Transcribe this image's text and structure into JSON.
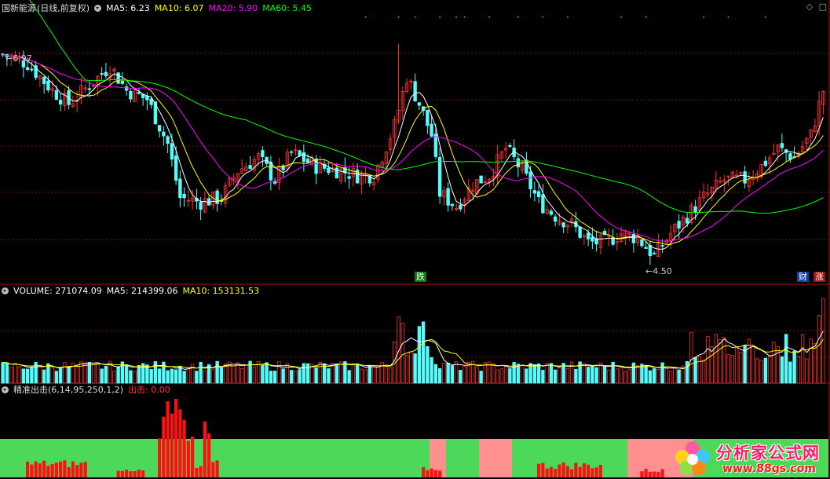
{
  "main_header": {
    "stock": "国新能源",
    "mode": "(日线,前复权)",
    "ma5": "MA5: 6.23",
    "ma10": "MA10: 6.07",
    "ma20": "MA20: 5.90",
    "ma60": "MA60: 5.45"
  },
  "vol_header": {
    "vol": "VOLUME: 271074.09",
    "ma5": "MA5: 214399.06",
    "ma10": "MA10: 153131.53"
  },
  "ind_header": {
    "name": "精准出击(6,14,95,250,1,2)",
    "value": "出击: 0.00"
  },
  "annotations": {
    "high_label": "6.97",
    "low_label": "4.50",
    "tag_fall": "跌",
    "tag_fin": "财",
    "tag_rise": "涨"
  },
  "watermark": {
    "title": "分析家公式网",
    "url": "www.88gs.com"
  },
  "icons": [
    "menu-dot-icon",
    "diamond-icon",
    "square-icon"
  ],
  "colors": {
    "up": "#ff3232",
    "down": "#54fcfc",
    "ma5": "#ffffff",
    "ma10": "#ffff00",
    "ma20": "#ff00ff",
    "ma60": "#00ff00",
    "grid": "#7a1010",
    "green_band": "#4cd95a",
    "pink_band": "#ff9090",
    "signal": "#ff1010"
  },
  "chart_data": [
    {
      "type": "candlestick",
      "y_range": [
        4.3,
        7.3
      ],
      "labeled_extremes": {
        "high": 6.97,
        "low": 4.5
      },
      "ma_latest": {
        "MA5": 6.23,
        "MA10": 6.07,
        "MA20": 5.9,
        "MA60": 5.45
      },
      "count": 200
    },
    {
      "type": "bar",
      "series": "VOLUME",
      "latest": {
        "VOLUME": 271074.09,
        "MA5": 214399.06,
        "MA10": 153131.53
      }
    },
    {
      "type": "area",
      "series": "出击",
      "latest": 0.0,
      "pink_bands": [
        [
          104,
          108
        ],
        [
          116,
          124
        ],
        [
          152,
          168
        ]
      ]
    }
  ]
}
